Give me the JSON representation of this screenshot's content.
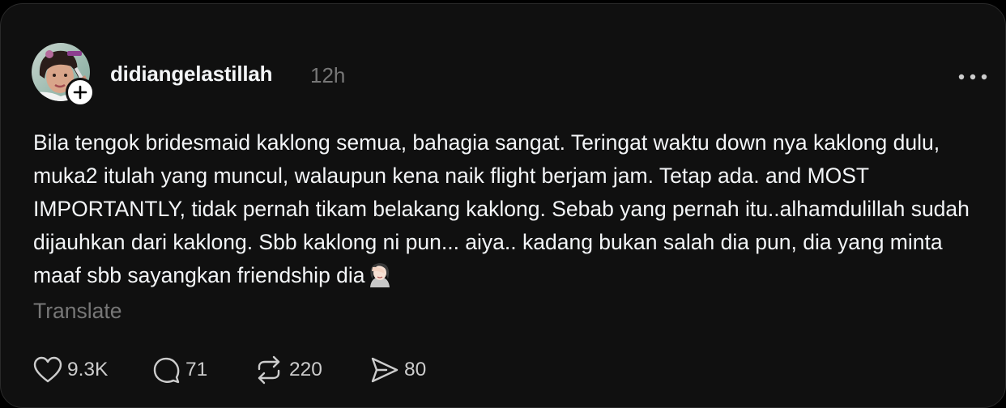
{
  "post": {
    "username": "didiangelastillah",
    "timestamp": "12h",
    "text": "Bila tengok bridesmaid kaklong semua, bahagia sangat. Teringat waktu down nya kaklong dulu, muka2 itulah yang muncul, walaupun kena naik flight berjam jam. Tetap ada. and MOST IMPORTANTLY, tidak pernah tikam belakang kaklong. Sebab yang pernah itu..alhamdulillah sudah dijauhkan dari kaklong. Sbb kaklong ni pun... aiya.. kadang bukan salah dia pun, dia yang minta maaf sbb sayangkan friendship dia",
    "emoji": "woman-facepalming-emoji",
    "translate_label": "Translate",
    "avatar_icon": "profile-photo",
    "follow_icon": "plus-icon",
    "more_icon": "more-dots-icon"
  },
  "actions": {
    "likes": "9.3K",
    "replies": "71",
    "reposts": "220",
    "shares": "80",
    "like_icon": "heart-icon",
    "reply_icon": "comment-icon",
    "repost_icon": "repost-icon",
    "share_icon": "send-icon"
  },
  "colors": {
    "background": "#101010",
    "text": "#f3f5f7",
    "muted": "#777777"
  }
}
